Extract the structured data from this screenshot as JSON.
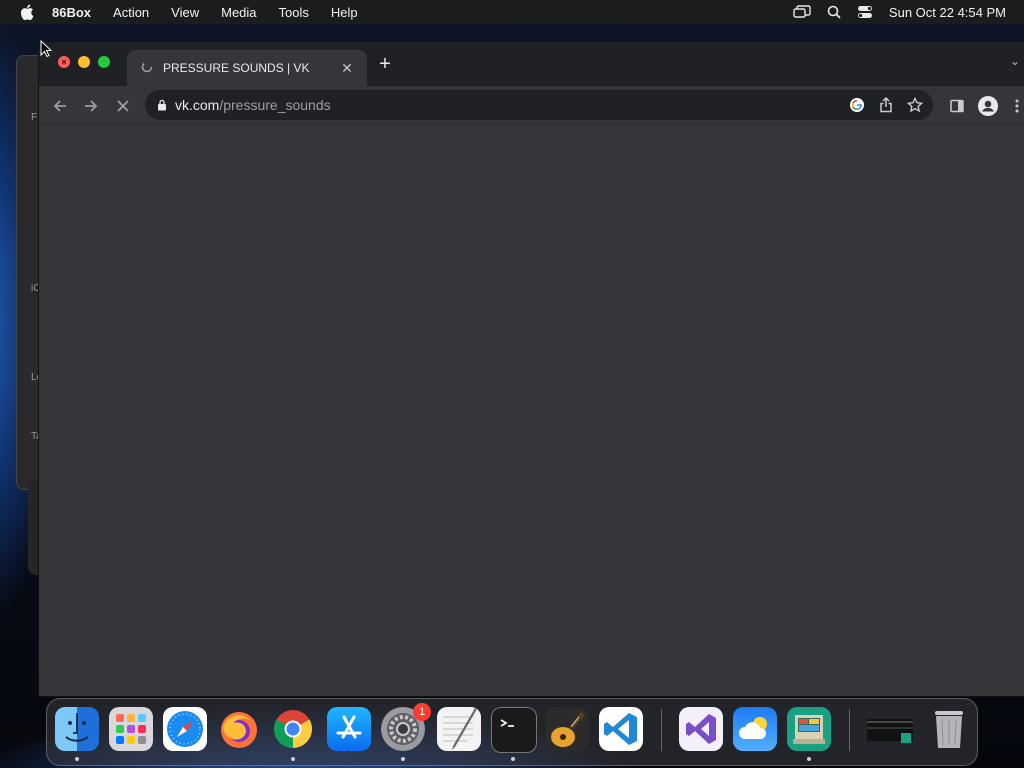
{
  "menubar": {
    "app_name": "86Box",
    "items": [
      "Action",
      "View",
      "Media",
      "Tools",
      "Help"
    ],
    "clock": "Sun Oct 22  4:54 PM"
  },
  "browser": {
    "tab_title": "PRESSURE SOUNDS | VK",
    "url_host": "vk.com",
    "url_path": "/pressure_sounds",
    "loading": true
  },
  "background_window": {
    "sidebar_glyphs": [
      "F",
      "iC",
      "Lo",
      "Ta"
    ]
  },
  "dock": {
    "apps": [
      {
        "name": "Finder",
        "running": true
      },
      {
        "name": "Launchpad",
        "running": false
      },
      {
        "name": "Safari",
        "running": false
      },
      {
        "name": "Firefox",
        "running": false
      },
      {
        "name": "Chrome",
        "running": true
      },
      {
        "name": "App Store",
        "running": false
      },
      {
        "name": "System Preferences",
        "running": true,
        "badge": "1"
      },
      {
        "name": "TextEdit",
        "running": false
      },
      {
        "name": "Terminal",
        "running": true
      },
      {
        "name": "GarageBand",
        "running": false
      },
      {
        "name": "Visual Studio Code",
        "running": false
      },
      {
        "name": "Visual Studio",
        "running": false
      },
      {
        "name": "Weather",
        "running": false
      },
      {
        "name": "86Box",
        "running": true
      },
      {
        "name": "Downloads",
        "running": false
      },
      {
        "name": "Trash",
        "running": false
      }
    ]
  },
  "colors": {
    "menubar_bg": "#1c1c1e",
    "tabstrip_bg": "#202124",
    "toolbar_bg": "#35363a",
    "omnibox_bg": "#202124",
    "close": "#ff5f57",
    "minimize": "#febc2e",
    "maximize": "#28c840"
  }
}
